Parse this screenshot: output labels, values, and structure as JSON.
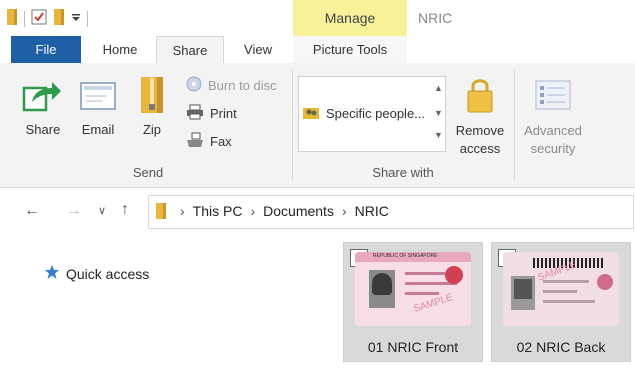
{
  "window": {
    "context_tab_group": "Manage",
    "title": "NRIC"
  },
  "tabs": {
    "file": "File",
    "home": "Home",
    "share": "Share",
    "view": "View",
    "picture_tools": "Picture Tools"
  },
  "ribbon": {
    "send": {
      "group_label": "Send",
      "share": "Share",
      "email": "Email",
      "zip": "Zip",
      "burn": "Burn to disc",
      "print": "Print",
      "fax": "Fax"
    },
    "share_with": {
      "group_label": "Share with",
      "specific": "Specific people...",
      "remove_line1": "Remove",
      "remove_line2": "access",
      "advanced_line1": "Advanced",
      "advanced_line2": "security"
    }
  },
  "address": {
    "crumbs": [
      "This PC",
      "Documents",
      "NRIC"
    ]
  },
  "navigation": {
    "quick_access": "Quick access"
  },
  "files": [
    {
      "name": "01 NRIC Front",
      "checked": true
    },
    {
      "name": "02 NRIC Back",
      "checked": true
    }
  ],
  "card_text": {
    "front_header": "REPUBLIC OF SINGAPORE",
    "watermark": "SAMPLE"
  },
  "colors": {
    "file_tab": "#1f5fa6",
    "manage_tab": "#f7f19a",
    "folder": "#e8b739",
    "share_arrow": "#2e9b4a",
    "quick_access_star": "#2f7fd8",
    "tile_selected": "#d9d9d9"
  }
}
